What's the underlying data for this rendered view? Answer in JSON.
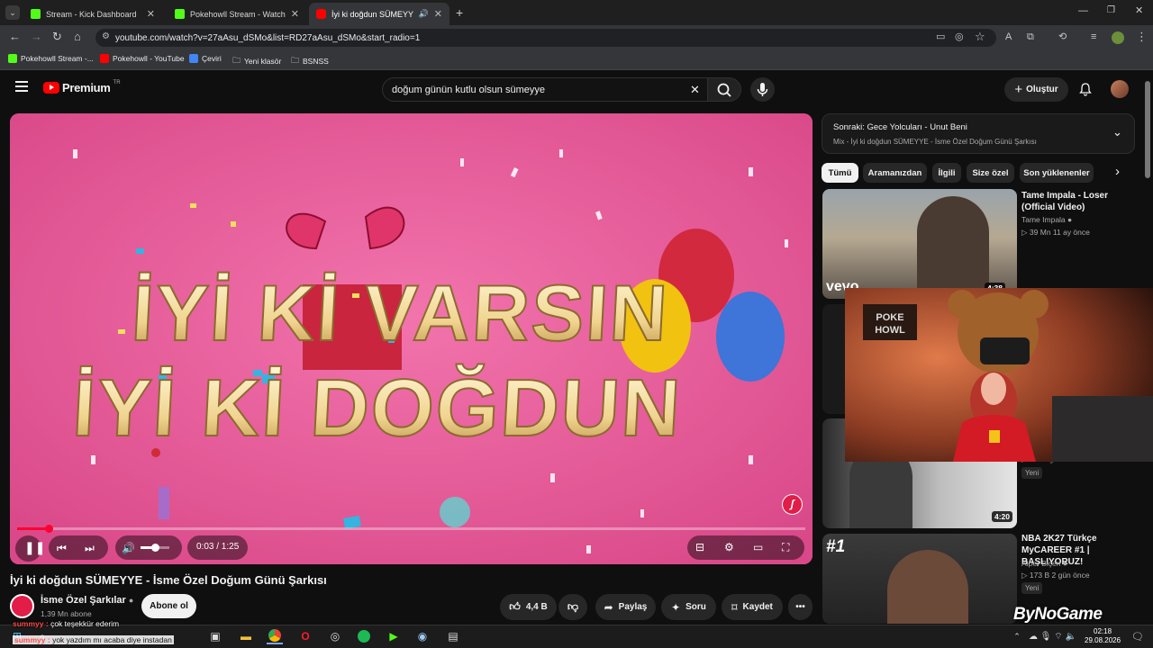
{
  "browser": {
    "tabs": [
      {
        "label": "Stream - Kick Dashboard",
        "color": "#53fc18"
      },
      {
        "label": "Pokehowll Stream - Watch Live",
        "color": "#53fc18"
      },
      {
        "label": "İyi ki doğdun SÜMEYYE - İs",
        "color": "#ff0000"
      }
    ],
    "url": "youtube.com/watch?v=27aAsu_dSMo&list=RD27aAsu_dSMo&start_radio=1",
    "bookmarks": [
      {
        "label": "Pokehowll Stream -...",
        "color": "#53fc18"
      },
      {
        "label": "Pokehowll - YouTube",
        "color": "#ff0000"
      },
      {
        "label": "Çeviri",
        "color": "#4285f4"
      },
      {
        "label": "Yeni klasör",
        "color": "#9aa0a6"
      },
      {
        "label": "BSNSS",
        "color": "#9aa0a6"
      }
    ]
  },
  "header": {
    "logo_text": "Premium",
    "logo_badge": "TR",
    "search_value": "doğum günün kutlu olsun sümeyye",
    "create_label": "Oluştur"
  },
  "player": {
    "overlay_line1": "İYİ Kİ VARSIN",
    "overlay_line2": "İYİ Kİ DOĞDUN",
    "time": "0:03 / 1:25",
    "progress_fraction": 0.04,
    "volume_fraction": 0.5
  },
  "video": {
    "title": "İyi ki doğdun SÜMEYYE - İsme Özel Doğum Günü Şarkısı",
    "channel": "İsme Özel Şarkılar",
    "subscribers": "1,39 Mn abone",
    "subscribe_label": "Abone ol",
    "likes": "4,4 B",
    "share_label": "Paylaş",
    "ask_label": "Soru",
    "save_label": "Kaydet"
  },
  "up_next": {
    "title": "Sonraki: Gece Yolcuları - Unut Beni",
    "subtitle": "Mix - İyi ki doğdun SÜMEYYE - İsme Özel Doğum Günü Şarkısı"
  },
  "chips": [
    "Tümü",
    "Aramanızdan",
    "İlgili",
    "Size özel",
    "Son yüklenenler"
  ],
  "recommendations": [
    {
      "title": "Tame Impala - Loser (Official Video)",
      "channel": "Tame Impala",
      "meta": "39 Mn   11 ay önce",
      "duration": "4:38",
      "thumb_label": "vevo"
    },
    {
      "title": "",
      "channel": "",
      "meta": "",
      "duration": "4:20",
      "new_label": "Yeni"
    },
    {
      "title": "NBA 2K27 Türkçe MyCAREER #1 | BAŞLIYORUZ!",
      "channel": "Alper Biçen",
      "meta": "173 B   2 gün önce",
      "new_label": "Yeni",
      "thumb_label": "#1"
    }
  ],
  "overlay": {
    "chat": [
      {
        "user": "summyy :",
        "text": "çok teşekkür ederim"
      },
      {
        "user": "summyy :",
        "text": "yok yazdım mı acaba diye instadan"
      }
    ],
    "watermark": "ByNoGame",
    "clock_time": "02:18",
    "clock_date": "29.08.2026"
  },
  "icons": {
    "menu": "menu-icon",
    "search": "search-icon",
    "mic": "mic-icon",
    "bell": "bell-icon"
  }
}
